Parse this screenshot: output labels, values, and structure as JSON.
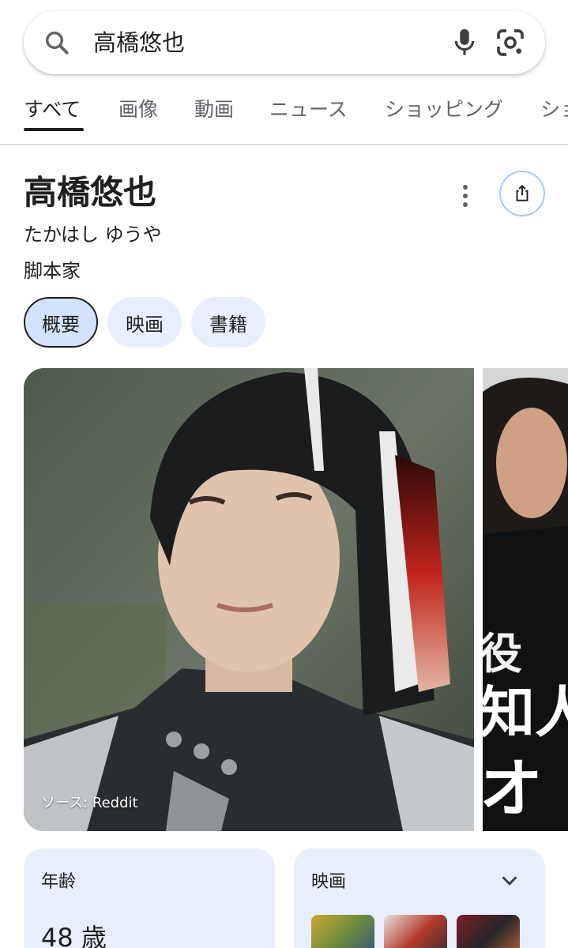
{
  "search": {
    "query": "高橋悠也",
    "icons": [
      "search-icon",
      "microphone-icon",
      "google-lens-icon"
    ]
  },
  "tabs": [
    {
      "label": "すべて",
      "active": true
    },
    {
      "label": "画像",
      "active": false
    },
    {
      "label": "動画",
      "active": false
    },
    {
      "label": "ニュース",
      "active": false
    },
    {
      "label": "ショッピング",
      "active": false
    },
    {
      "label": "ショ",
      "active": false
    }
  ],
  "panel": {
    "title": "高橋悠也",
    "reading": "たかはし ゆうや",
    "subtitle": "脚本家",
    "chips": [
      {
        "label": "概要",
        "active": true
      },
      {
        "label": "映画",
        "active": false
      },
      {
        "label": "書籍",
        "active": false
      }
    ],
    "image_source": "ソース: Reddit"
  },
  "cards": {
    "age_label": "年齢",
    "age_value": "48 歳",
    "movies_label": "映画"
  },
  "colors": {
    "chip_bg": "#e8eefc",
    "chip_active_bg": "#d3e3fd",
    "share_border": "#a8c7fa",
    "card_bg": "#e8eefc"
  }
}
